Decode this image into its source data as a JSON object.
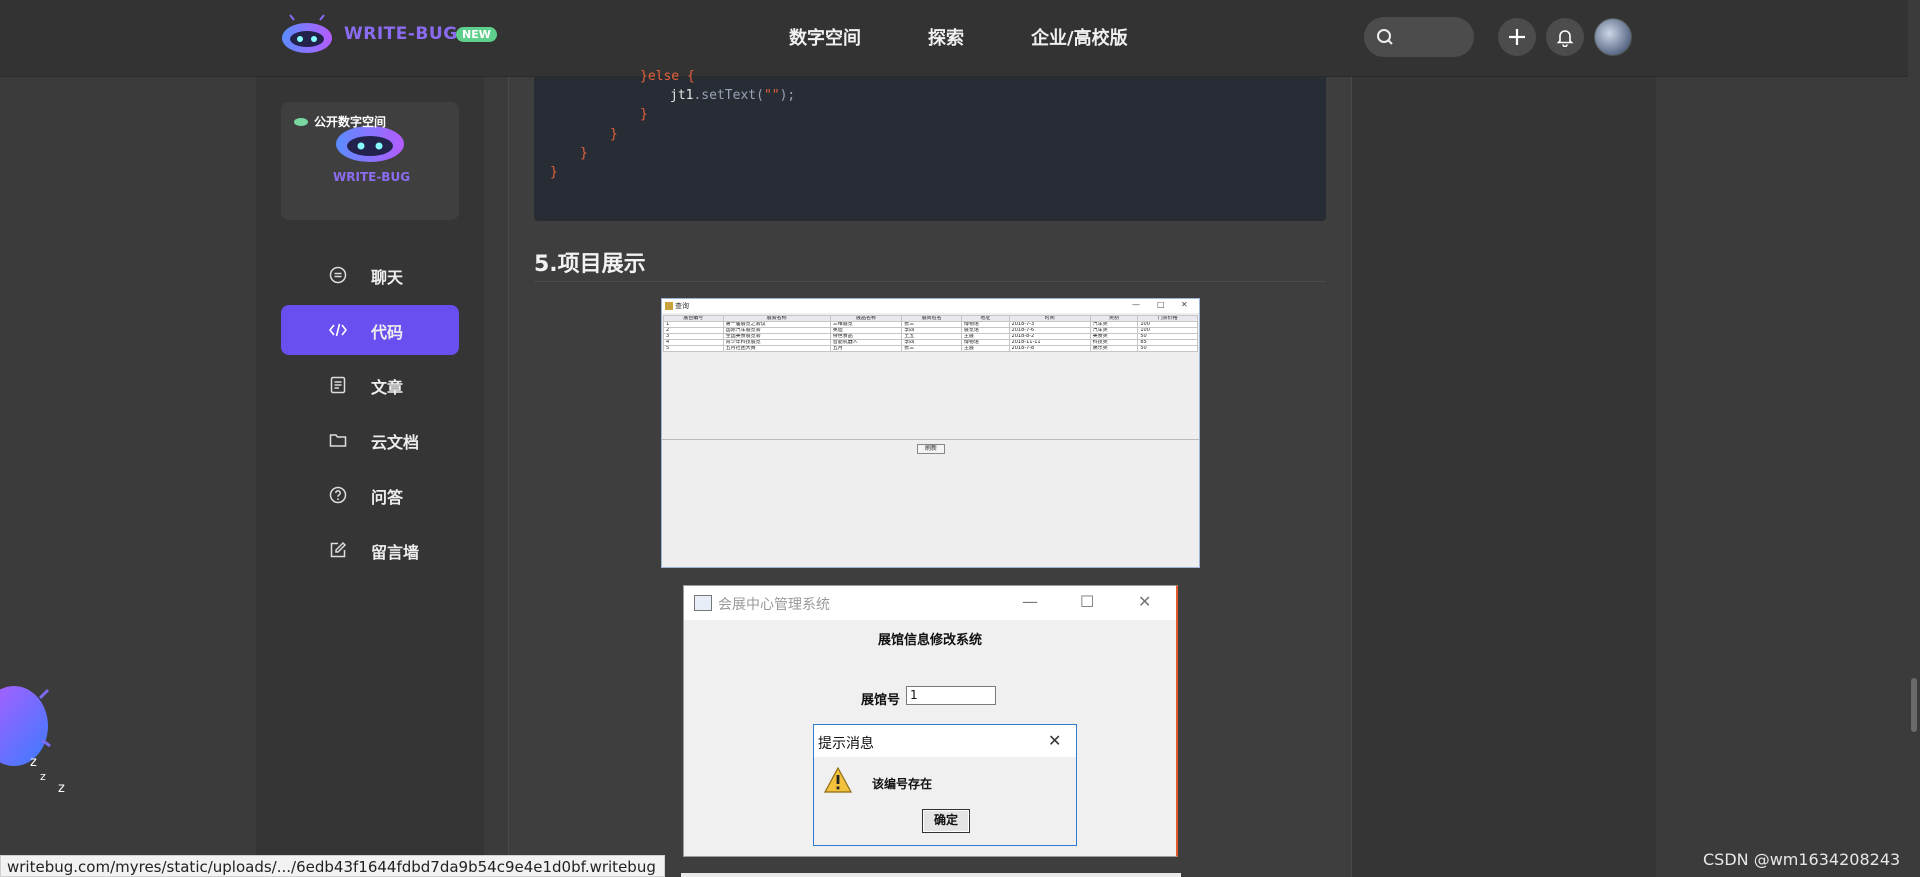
{
  "header": {
    "brand": "WRITE-BUG",
    "new_badge": "NEW",
    "nav": [
      "数字空间",
      "探索",
      "企业/高校版"
    ],
    "search_icon": "search-icon",
    "add_icon": "plus-icon",
    "bell_icon": "bell-icon"
  },
  "sidebar": {
    "space_tag": "公开数字空间",
    "space_brand": "WRITE-BUG",
    "items": [
      {
        "label": "聊天",
        "icon": "chat-icon",
        "active": false
      },
      {
        "label": "代码",
        "icon": "code-icon",
        "active": true
      },
      {
        "label": "文章",
        "icon": "article-icon",
        "active": false
      },
      {
        "label": "云文档",
        "icon": "folder-icon",
        "active": false
      },
      {
        "label": "问答",
        "icon": "question-icon",
        "active": false
      },
      {
        "label": "留言墙",
        "icon": "edit-icon",
        "active": false
      }
    ]
  },
  "code": {
    "lines": [
      {
        "parts": [
          {
            "t": "}else {",
            "c": "orange"
          }
        ]
      },
      {
        "parts": [
          {
            "t": "jt1",
            "c": "white"
          },
          {
            "t": ".setText(",
            "c": "grey"
          },
          {
            "t": "\"\"",
            "c": "orange"
          },
          {
            "t": ");",
            "c": "grey"
          }
        ]
      },
      {
        "parts": [
          {
            "t": "}",
            "c": "orange"
          }
        ]
      },
      {
        "parts": [
          {
            "t": "}",
            "c": "orange"
          }
        ]
      },
      {
        "parts": [
          {
            "t": "}",
            "c": "orange"
          }
        ]
      },
      {
        "parts": [
          {
            "t": "}",
            "c": "orange"
          }
        ]
      }
    ]
  },
  "article": {
    "heading": "5.项目展示"
  },
  "screenshot1": {
    "title": "查询",
    "controls": [
      "—",
      "□",
      "✕"
    ],
    "columns": [
      "展台编号",
      "展会名称",
      "展品名称",
      "展商姓名",
      "地址",
      "时间",
      "类别",
      "门票价格"
    ],
    "rows": [
      [
        "1",
        "第一届展览之会议",
        "三维展览",
        "张三",
        "博物馆",
        "2018-7-3",
        "汽车类",
        "100"
      ],
      [
        "2",
        "国际汽车展览会",
        "奥迪",
        "李四",
        "展览馆",
        "2018-7-6",
        "汽车类",
        "100"
      ],
      [
        "3",
        "全国美食展览会",
        "特色食品",
        "王五",
        "主展",
        "2018-8-2",
        "美食类",
        "50"
      ],
      [
        "4",
        "青少年科技展览",
        "智能机器人",
        "李四",
        "博物馆",
        "2018-11-11",
        "科技类",
        "85"
      ],
      [
        "5",
        "五月社团大赛",
        "五月",
        "张三",
        "主展",
        "2018-7-8",
        "娱乐类",
        "50"
      ]
    ],
    "button": "刷新"
  },
  "screenshot2": {
    "title": "会展中心管理系统",
    "controls": [
      "—",
      "☐",
      "✕"
    ],
    "subtitle": "展馆信息修改系统",
    "field_label": "展馆号",
    "field_value": "1"
  },
  "dialog": {
    "title": "提示消息",
    "message": "该编号存在",
    "ok": "确定"
  },
  "status_url": "writebug.com/myres/static/uploads/.../6edb43f1644fdbd7da9b54c9e4e1d0bf.writebug",
  "watermark": "CSDN @wm1634208243",
  "colors": {
    "accent": "#6a4ff0",
    "brand": "#8b6cf0",
    "badge": "#5fd08b",
    "code_bg": "#282c34"
  }
}
